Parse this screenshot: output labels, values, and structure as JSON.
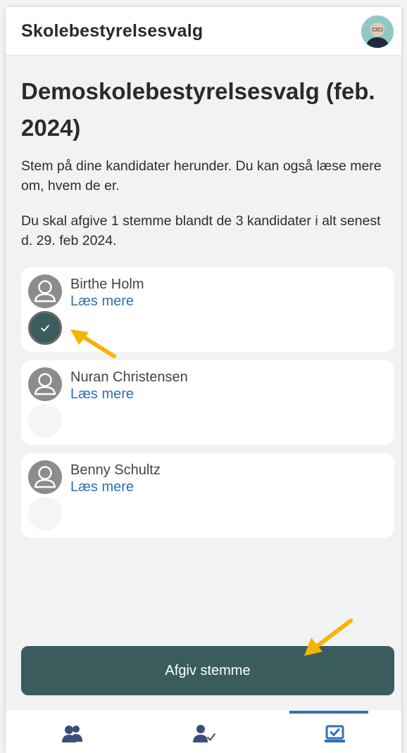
{
  "header": {
    "app_title": "Skolebestyrelsesvalg"
  },
  "page": {
    "title": "Demoskolebestyrelsesvalg (feb. 2024)",
    "intro": "Stem på dine kandidater herunder. Du kan også læse mere om, hvem de er.",
    "instructions": "Du skal afgive 1 stemme blandt de 3 kandidater i alt senest d. 29. feb 2024."
  },
  "candidates": [
    {
      "name": "Birthe Holm",
      "read_more": "Læs mere",
      "selected": true
    },
    {
      "name": "Nuran Christensen",
      "read_more": "Læs mere",
      "selected": false
    },
    {
      "name": "Benny Schultz",
      "read_more": "Læs mere",
      "selected": false
    }
  ],
  "actions": {
    "submit_label": "Afgiv stemme"
  },
  "tabs": [
    {
      "icon": "group-icon",
      "active": false
    },
    {
      "icon": "user-check-icon",
      "active": false
    },
    {
      "icon": "ballot-check-icon",
      "active": true
    }
  ],
  "colors": {
    "primary": "#3a5c5c",
    "link": "#2f6fb5",
    "annotation_arrow": "#f5b400"
  }
}
